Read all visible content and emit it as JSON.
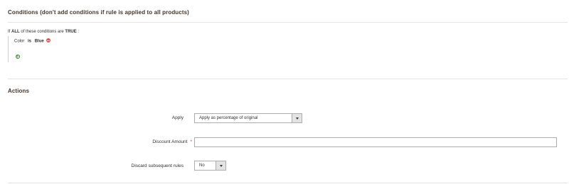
{
  "conditions": {
    "title": "Conditions (don't add conditions if rule is applied to all products)",
    "head_prefix": "If",
    "aggregator": "ALL",
    "head_middle": "of these conditions are",
    "value": "TRUE",
    "head_suffix": ":",
    "items": [
      {
        "attribute": "Color",
        "operator": "is",
        "value": "Blue"
      }
    ]
  },
  "actions": {
    "title": "Actions",
    "apply": {
      "label": "Apply",
      "value": "Apply as percentage of original"
    },
    "discount_amount": {
      "label": "Discount Amount",
      "required_mark": "*",
      "value": ""
    },
    "discard_rules": {
      "label": "Discard subsequent rules",
      "value": "No"
    }
  }
}
